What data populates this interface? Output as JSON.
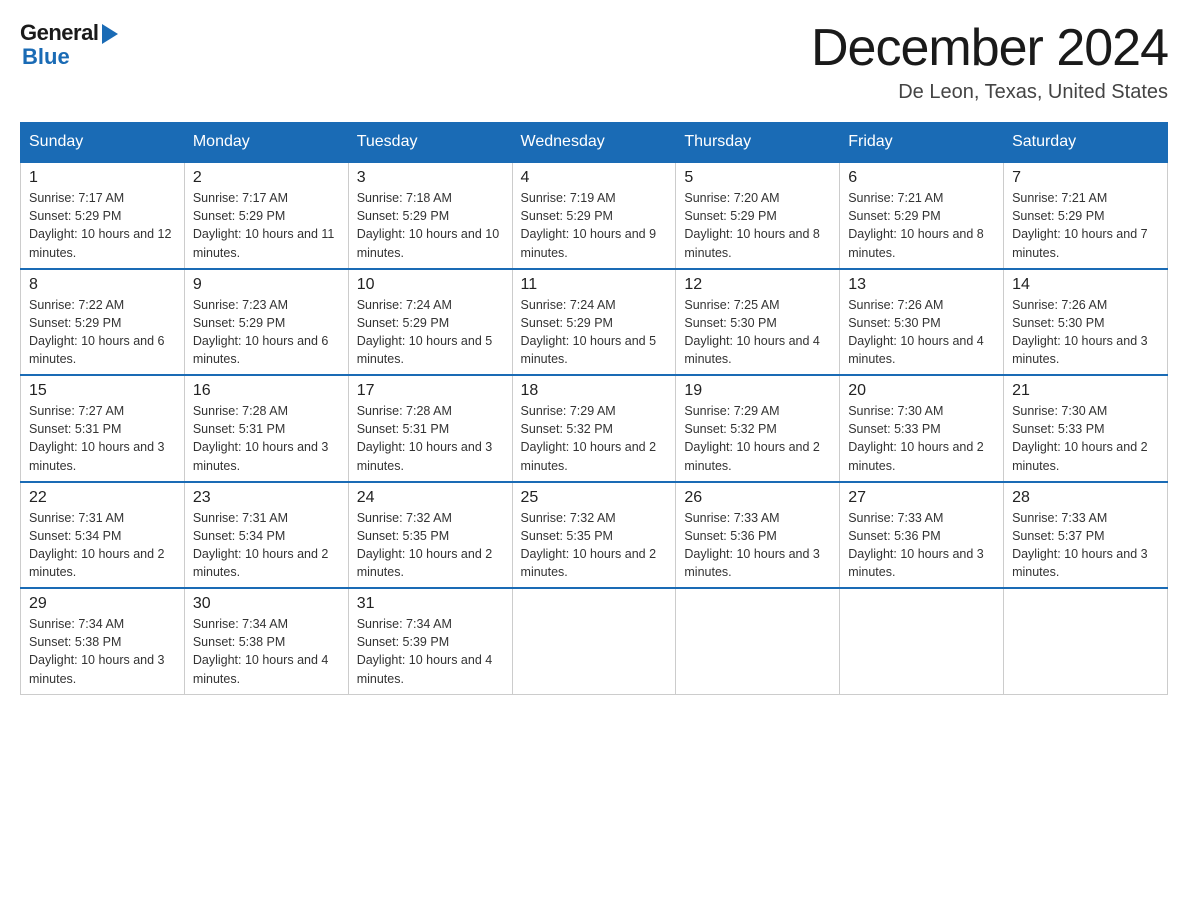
{
  "header": {
    "logo_general": "General",
    "logo_blue": "Blue",
    "month_title": "December 2024",
    "location": "De Leon, Texas, United States"
  },
  "days_of_week": [
    "Sunday",
    "Monday",
    "Tuesday",
    "Wednesday",
    "Thursday",
    "Friday",
    "Saturday"
  ],
  "weeks": [
    [
      {
        "num": "1",
        "sunrise": "7:17 AM",
        "sunset": "5:29 PM",
        "daylight": "10 hours and 12 minutes."
      },
      {
        "num": "2",
        "sunrise": "7:17 AM",
        "sunset": "5:29 PM",
        "daylight": "10 hours and 11 minutes."
      },
      {
        "num": "3",
        "sunrise": "7:18 AM",
        "sunset": "5:29 PM",
        "daylight": "10 hours and 10 minutes."
      },
      {
        "num": "4",
        "sunrise": "7:19 AM",
        "sunset": "5:29 PM",
        "daylight": "10 hours and 9 minutes."
      },
      {
        "num": "5",
        "sunrise": "7:20 AM",
        "sunset": "5:29 PM",
        "daylight": "10 hours and 8 minutes."
      },
      {
        "num": "6",
        "sunrise": "7:21 AM",
        "sunset": "5:29 PM",
        "daylight": "10 hours and 8 minutes."
      },
      {
        "num": "7",
        "sunrise": "7:21 AM",
        "sunset": "5:29 PM",
        "daylight": "10 hours and 7 minutes."
      }
    ],
    [
      {
        "num": "8",
        "sunrise": "7:22 AM",
        "sunset": "5:29 PM",
        "daylight": "10 hours and 6 minutes."
      },
      {
        "num": "9",
        "sunrise": "7:23 AM",
        "sunset": "5:29 PM",
        "daylight": "10 hours and 6 minutes."
      },
      {
        "num": "10",
        "sunrise": "7:24 AM",
        "sunset": "5:29 PM",
        "daylight": "10 hours and 5 minutes."
      },
      {
        "num": "11",
        "sunrise": "7:24 AM",
        "sunset": "5:29 PM",
        "daylight": "10 hours and 5 minutes."
      },
      {
        "num": "12",
        "sunrise": "7:25 AM",
        "sunset": "5:30 PM",
        "daylight": "10 hours and 4 minutes."
      },
      {
        "num": "13",
        "sunrise": "7:26 AM",
        "sunset": "5:30 PM",
        "daylight": "10 hours and 4 minutes."
      },
      {
        "num": "14",
        "sunrise": "7:26 AM",
        "sunset": "5:30 PM",
        "daylight": "10 hours and 3 minutes."
      }
    ],
    [
      {
        "num": "15",
        "sunrise": "7:27 AM",
        "sunset": "5:31 PM",
        "daylight": "10 hours and 3 minutes."
      },
      {
        "num": "16",
        "sunrise": "7:28 AM",
        "sunset": "5:31 PM",
        "daylight": "10 hours and 3 minutes."
      },
      {
        "num": "17",
        "sunrise": "7:28 AM",
        "sunset": "5:31 PM",
        "daylight": "10 hours and 3 minutes."
      },
      {
        "num": "18",
        "sunrise": "7:29 AM",
        "sunset": "5:32 PM",
        "daylight": "10 hours and 2 minutes."
      },
      {
        "num": "19",
        "sunrise": "7:29 AM",
        "sunset": "5:32 PM",
        "daylight": "10 hours and 2 minutes."
      },
      {
        "num": "20",
        "sunrise": "7:30 AM",
        "sunset": "5:33 PM",
        "daylight": "10 hours and 2 minutes."
      },
      {
        "num": "21",
        "sunrise": "7:30 AM",
        "sunset": "5:33 PM",
        "daylight": "10 hours and 2 minutes."
      }
    ],
    [
      {
        "num": "22",
        "sunrise": "7:31 AM",
        "sunset": "5:34 PM",
        "daylight": "10 hours and 2 minutes."
      },
      {
        "num": "23",
        "sunrise": "7:31 AM",
        "sunset": "5:34 PM",
        "daylight": "10 hours and 2 minutes."
      },
      {
        "num": "24",
        "sunrise": "7:32 AM",
        "sunset": "5:35 PM",
        "daylight": "10 hours and 2 minutes."
      },
      {
        "num": "25",
        "sunrise": "7:32 AM",
        "sunset": "5:35 PM",
        "daylight": "10 hours and 2 minutes."
      },
      {
        "num": "26",
        "sunrise": "7:33 AM",
        "sunset": "5:36 PM",
        "daylight": "10 hours and 3 minutes."
      },
      {
        "num": "27",
        "sunrise": "7:33 AM",
        "sunset": "5:36 PM",
        "daylight": "10 hours and 3 minutes."
      },
      {
        "num": "28",
        "sunrise": "7:33 AM",
        "sunset": "5:37 PM",
        "daylight": "10 hours and 3 minutes."
      }
    ],
    [
      {
        "num": "29",
        "sunrise": "7:34 AM",
        "sunset": "5:38 PM",
        "daylight": "10 hours and 3 minutes."
      },
      {
        "num": "30",
        "sunrise": "7:34 AM",
        "sunset": "5:38 PM",
        "daylight": "10 hours and 4 minutes."
      },
      {
        "num": "31",
        "sunrise": "7:34 AM",
        "sunset": "5:39 PM",
        "daylight": "10 hours and 4 minutes."
      },
      null,
      null,
      null,
      null
    ]
  ],
  "labels": {
    "sunrise": "Sunrise:",
    "sunset": "Sunset:",
    "daylight": "Daylight:"
  }
}
